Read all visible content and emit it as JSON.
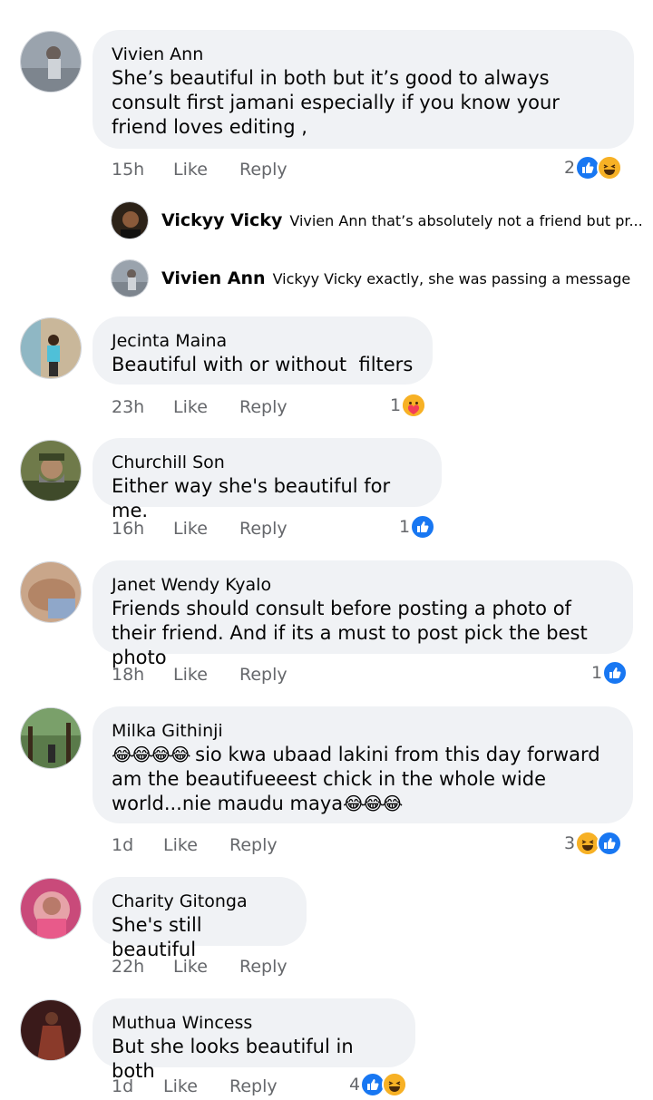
{
  "comments": [
    {
      "author": "Vivien Ann",
      "text": "She’s beautiful in both but it’s good to always consult first jamani especially if you know your friend loves editing ,",
      "time": "15h",
      "like": "Like",
      "reply": "Reply",
      "reaction_count": "2",
      "reactions": [
        "like-icon",
        "haha-icon"
      ],
      "replies": [
        {
          "author": "Vickyy Vicky",
          "text": "Vivien Ann  that’s absolutely not a friend but pr..."
        },
        {
          "author": "Vivien Ann",
          "text": "Vickyy Vicky  exactly, she was passing a message"
        }
      ]
    },
    {
      "author": "Jecinta Maina",
      "text": "Beautiful with or without  filters",
      "time": "23h",
      "like": "Like",
      "reply": "Reply",
      "reaction_count": "1",
      "reactions": [
        "care-icon"
      ]
    },
    {
      "author": "Churchill Son",
      "text": "Either way she's beautiful for me.",
      "time": "16h",
      "like": "Like",
      "reply": "Reply",
      "reaction_count": "1",
      "reactions": [
        "like-icon"
      ]
    },
    {
      "author": "Janet Wendy Kyalo",
      "text": "Friends should consult before posting a photo of their friend. And if its a must to post pick the best photo",
      "time": "18h",
      "like": "Like",
      "reply": "Reply",
      "reaction_count": "1",
      "reactions": [
        "like-icon"
      ]
    },
    {
      "author": "Milka Githinji",
      "emoji_prefix": "😂😂😂😂",
      "text": " sio kwa ubaad lakini from this day forward am the beautifueeest chick in the whole wide world...nie maudu maya",
      "emoji_suffix": "😂😂😂",
      "time": "1d",
      "like": "Like",
      "reply": "Reply",
      "reaction_count": "3",
      "reactions": [
        "haha-icon",
        "like-icon"
      ]
    },
    {
      "author": "Charity Gitonga",
      "text": "She's still beautiful",
      "time": "22h",
      "like": "Like",
      "reply": "Reply"
    },
    {
      "author": "Muthua Wincess",
      "text": "But she looks beautiful in both",
      "time": "1d",
      "like": "Like",
      "reply": "Reply",
      "reaction_count": "4",
      "reactions": [
        "like-icon",
        "haha-icon"
      ]
    }
  ],
  "colors": {
    "bubble": "#f0f2f5",
    "meta_text": "#65676b",
    "like_blue": "#1877f2",
    "haha_yellow": "#f7b125"
  }
}
